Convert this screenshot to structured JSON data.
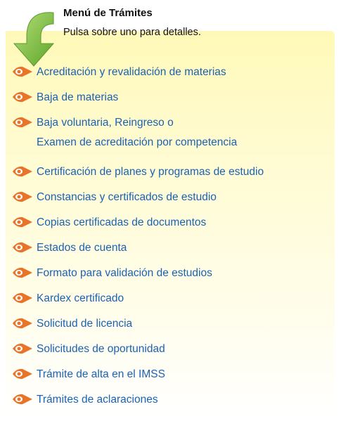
{
  "header": {
    "title": "Menú de Trámites",
    "subtitle": "Pulsa sobre uno para detalles.",
    "icon": "green-down-arrow-icon"
  },
  "colors": {
    "link": "#1b62b3",
    "bullet": "#e8742a",
    "arrow": "#7ac043",
    "panel": "#fffbd0"
  },
  "menu": {
    "items": [
      {
        "line1": "Acreditación y revalidación de materias"
      },
      {
        "line1": "Baja de materias"
      },
      {
        "line1": "Baja voluntaria, Reingreso o",
        "line2": "Examen de acreditación por competencia"
      },
      {
        "line1": "Certificación de planes y programas de estudio"
      },
      {
        "line1": "Constancias y certificados de estudio"
      },
      {
        "line1": "Copias certificadas de documentos"
      },
      {
        "line1": "Estados de cuenta"
      },
      {
        "line1": "Formato para validación de estudios"
      },
      {
        "line1": "Kardex certificado"
      },
      {
        "line1": "Solicitud de licencia"
      },
      {
        "line1": "Solicitudes de oportunidad"
      },
      {
        "line1": "Trámite de alta en el IMSS"
      },
      {
        "line1": "Trámites de aclaraciones"
      }
    ]
  }
}
